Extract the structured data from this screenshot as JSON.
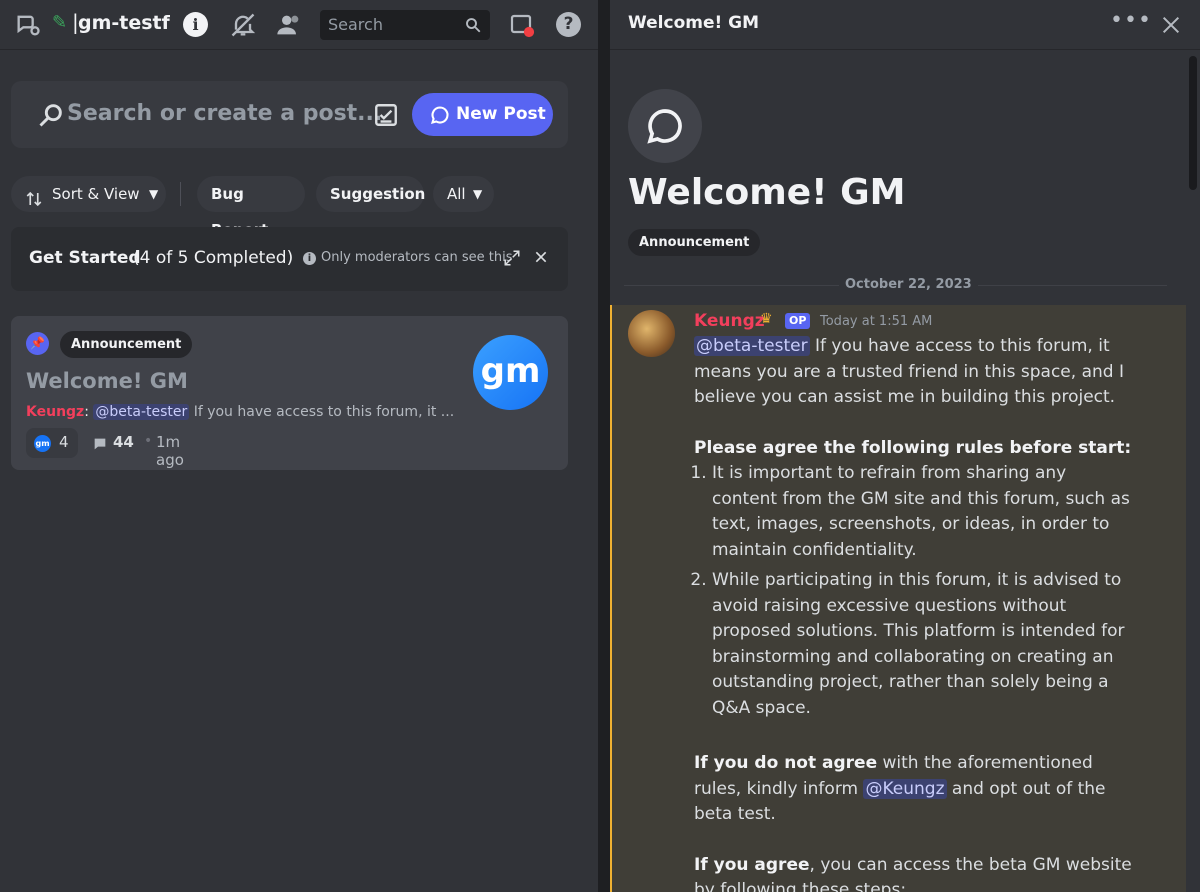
{
  "left": {
    "channel_name": "gm-testfli",
    "top_search_placeholder": "Search",
    "search_placeholder": "Search or create a post...",
    "new_post_label": "New Post",
    "sort_label": "Sort & View",
    "tags": [
      "Bug Report",
      "Suggestion"
    ],
    "all_label": "All",
    "get_started": {
      "title": "Get Started",
      "count": "(4 of 5 Completed)",
      "note": "Only moderators can see this"
    },
    "post": {
      "tag": "Announcement",
      "title": "Welcome! GM",
      "author": "Keungz",
      "mention": "@beta-tester",
      "preview": "If you have access to this forum, it ...",
      "thumb_text": "gm",
      "reaction_emoji": "gm",
      "reaction_count": "4",
      "reply_count": "44",
      "time_ago": "1m ago"
    }
  },
  "right": {
    "header_title": "Welcome! GM",
    "title": "Welcome! GM",
    "tag": "Announcement",
    "date": "October 22, 2023",
    "message": {
      "author": "Keungz",
      "badge": "OP",
      "timestamp": "Today at 1:51 AM",
      "mention": "@beta-tester",
      "intro": "If you have access to this forum, it means you are a trusted friend in this space, and I believe you can assist me in building this project.",
      "rules_heading": "Please agree the following rules before start:",
      "rules": [
        "It is important to refrain from sharing any content from the GM site and this forum, such as text, images, screenshots, or ideas, in order to maintain confidentiality.",
        "While participating in this forum, it is advised to avoid raising excessive questions without proposed solutions. This platform is intended for brainstorming and collaborating on creating an outstanding project, rather than solely being a Q&A space."
      ],
      "disagree_bold": "If you do not agree",
      "disagree_text": "with the aforementioned rules, kindly inform",
      "disagree_mention": "@Keungz",
      "disagree_tail": "and opt out of the beta test.",
      "agree_bold": "If you agree",
      "agree_text": ", you can access the beta GM website by following these steps:"
    }
  }
}
